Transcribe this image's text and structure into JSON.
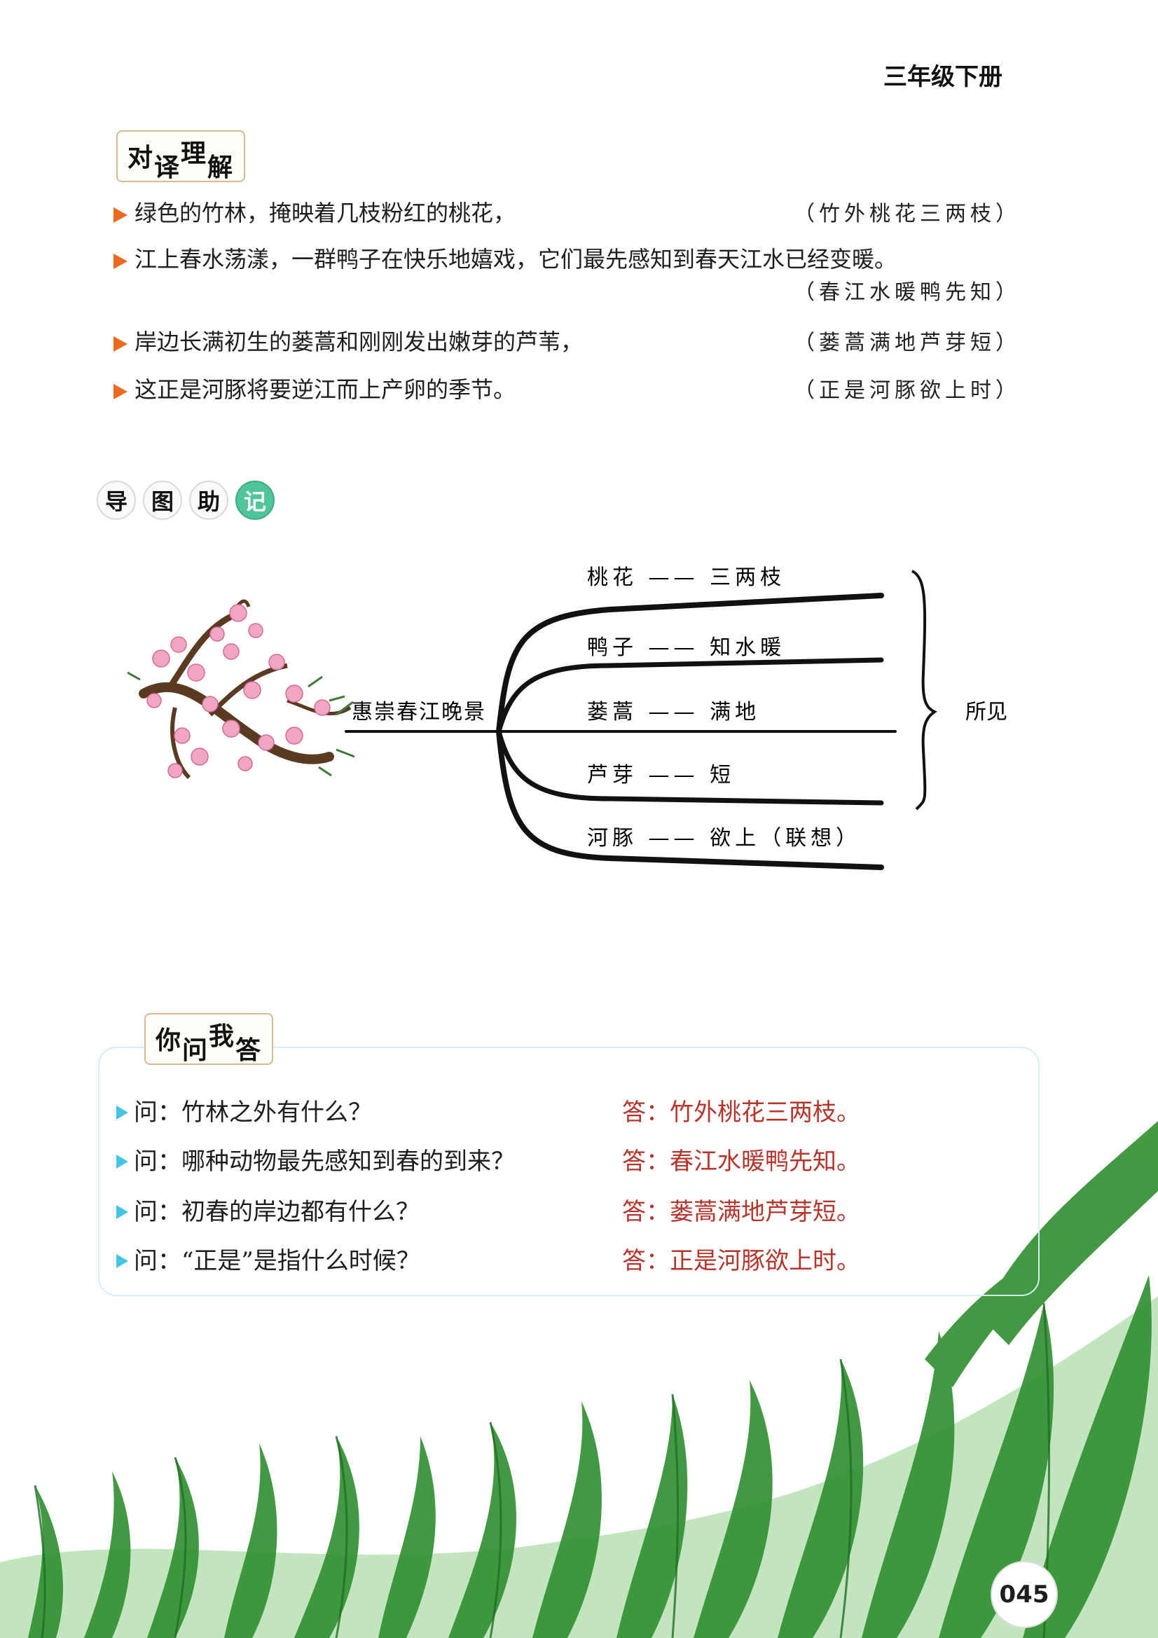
{
  "header": {
    "grade": "三年级下册"
  },
  "translation_section": {
    "badge": [
      "对",
      "译",
      "理",
      "解"
    ],
    "rows": [
      {
        "text": "绿色的竹林，掩映着几枝粉红的桃花，",
        "poem": "（竹外桃花三两枝）"
      },
      {
        "text": "江上春水荡漾，一群鸭子在快乐地嬉戏，它们最先感知到春天江水已经变暖。",
        "poem": "（春江水暖鸭先知）"
      },
      {
        "text": "岸边长满初生的蒌蒿和刚刚发出嫩芽的芦苇，",
        "poem": "（蒌蒿满地芦芽短）"
      },
      {
        "text": "这正是河豚将要逆江而上产卵的季节。",
        "poem": "（正是河豚欲上时）"
      }
    ]
  },
  "map_section": {
    "badge": [
      "导",
      "图",
      "助",
      "记"
    ],
    "center": "惠崇春江晚景",
    "branches": [
      "桃花 —— 三两枝",
      "鸭子 —— 知水暖",
      "蒌蒿 —— 满地",
      "芦芽 —— 短",
      "河豚 —— 欲上（联想）"
    ],
    "side_label": "所见"
  },
  "qa_section": {
    "badge": [
      "你",
      "问",
      "我",
      "答"
    ],
    "items": [
      {
        "q": "问：竹林之外有什么？",
        "a": "答：竹外桃花三两枝。"
      },
      {
        "q": "问：哪种动物最先感知到春的到来？",
        "a": "答：春江水暖鸭先知。"
      },
      {
        "q": "问：初春的岸边都有什么？",
        "a": "答：蒌蒿满地芦芽短。"
      },
      {
        "q": "问：“正是”是指什么时候？",
        "a": "答：正是河豚欲上时。"
      }
    ]
  },
  "page_number": "045",
  "colors": {
    "bullet_orange": "#ea6a1f",
    "bullet_cyan": "#45c5e5",
    "answer_red": "#b5352c",
    "badge_green": "#4fc59a",
    "grass_green": "#2f8f2f"
  }
}
